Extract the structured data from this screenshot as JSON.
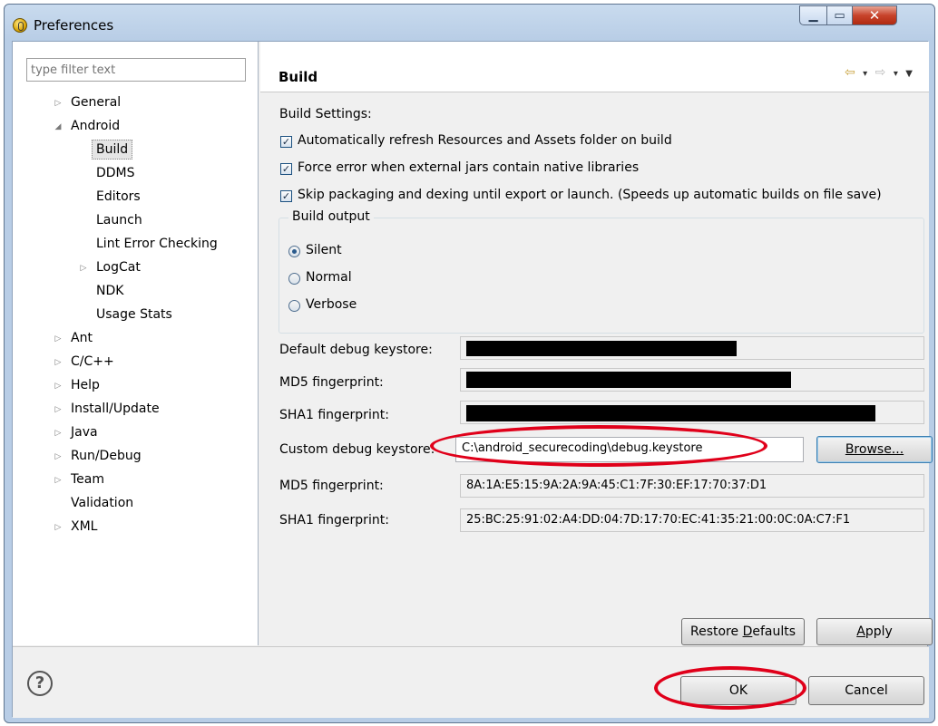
{
  "window": {
    "title": "Preferences",
    "min_icon": "▁",
    "max_icon": "▭",
    "close_icon": "✕"
  },
  "filter": {
    "placeholder": "type filter text"
  },
  "tree": [
    {
      "label": "General",
      "expander": "▷"
    },
    {
      "label": "Android",
      "expander": "◢"
    },
    {
      "label": "Build",
      "expander": "",
      "selected": true
    },
    {
      "label": "DDMS",
      "expander": ""
    },
    {
      "label": "Editors",
      "expander": ""
    },
    {
      "label": "Launch",
      "expander": ""
    },
    {
      "label": "Lint Error Checking",
      "expander": ""
    },
    {
      "label": "LogCat",
      "expander": "▷"
    },
    {
      "label": "NDK",
      "expander": ""
    },
    {
      "label": "Usage Stats",
      "expander": ""
    },
    {
      "label": "Ant",
      "expander": "▷"
    },
    {
      "label": "C/C++",
      "expander": "▷"
    },
    {
      "label": "Help",
      "expander": "▷"
    },
    {
      "label": "Install/Update",
      "expander": "▷"
    },
    {
      "label": "Java",
      "expander": "▷"
    },
    {
      "label": "Run/Debug",
      "expander": "▷"
    },
    {
      "label": "Team",
      "expander": "▷"
    },
    {
      "label": "Validation",
      "expander": ""
    },
    {
      "label": "XML",
      "expander": "▷"
    }
  ],
  "page": {
    "title": "Build",
    "nav": {
      "back": "⇦",
      "forward": "⇨",
      "dropdown": "▾",
      "menu": "▼"
    },
    "section_label": "Build Settings:",
    "checkboxes": [
      {
        "label": "Automatically refresh Resources and Assets folder on build",
        "checked": true
      },
      {
        "label": "Force error when external jars contain native libraries",
        "checked": true
      },
      {
        "label": "Skip packaging and dexing until export or launch. (Speeds up automatic builds on file save)",
        "checked": true
      }
    ],
    "check_mark": "✓",
    "build_output": {
      "title": "Build output",
      "options": [
        {
          "label": "Silent",
          "selected": true
        },
        {
          "label": "Normal",
          "selected": false
        },
        {
          "label": "Verbose",
          "selected": false
        }
      ]
    },
    "fields": {
      "default_keystore_label": "Default debug keystore:",
      "md5_label_1": "MD5 fingerprint:",
      "sha1_label_1": "SHA1 fingerprint:",
      "custom_keystore_label": "Custom debug keystore:",
      "custom_keystore_value": "C:\\android_securecoding\\debug.keystore",
      "browse_label": "Browse...",
      "md5_label_2": "MD5 fingerprint:",
      "md5_value_2": "8A:1A:E5:15:9A:2A:9A:45:C1:7F:30:EF:17:70:37:D1",
      "sha1_label_2": "SHA1 fingerprint:",
      "sha1_value_2": "25:BC:25:91:02:A4:DD:04:7D:17:70:EC:41:35:21:00:0C:0A:C7:F1"
    },
    "restore_defaults": {
      "pre": "Restore ",
      "u": "D",
      "post": "efaults"
    },
    "apply": {
      "u": "A",
      "post": "pply"
    }
  },
  "footer": {
    "help_icon": "?",
    "ok_label": "OK",
    "cancel_label": "Cancel"
  },
  "colors": {
    "highlight_ellipse": "#e0001a",
    "window_frame": "#b8cde6",
    "selection": "#e5e5e5"
  }
}
